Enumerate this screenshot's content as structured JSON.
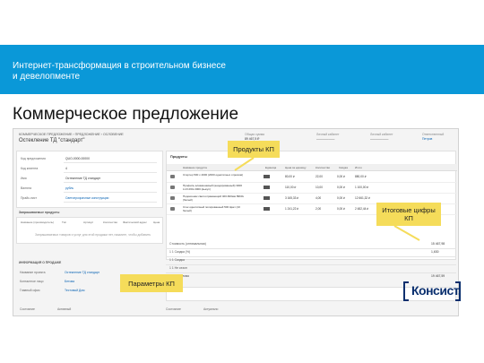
{
  "banner": {
    "title_line1": "Интернет-трансформация в строительном бизнесе",
    "title_line2": "и девелопменте"
  },
  "page_title": "Коммерческое предложение",
  "screenshot": {
    "breadcrumb": "КОММЕРЧЕСКОЕ ПРЕДЛОЖЕНИЕ › ПРЕДЛОЖЕНИЕ › ОСЛОВЕНИЕ",
    "record_name": "Остекление ТД \"стандарт\"",
    "header_cols": [
      {
        "label": "Общая сумма",
        "value": "89 467,5 ₽",
        "link": false
      },
      {
        "label": "Личный кабинет",
        "value": "——————",
        "link": false
      },
      {
        "label": "Личный кабинет",
        "value": "——————",
        "link": false
      },
      {
        "label": "Ответственный",
        "value": "Петров",
        "link": true
      }
    ],
    "fields": [
      {
        "label": "Код предложения",
        "value": "QUO-0000-00000",
        "link": false
      },
      {
        "label": "Код клиента",
        "value": "4",
        "link": false
      },
      {
        "label": "Имя",
        "value": "Остекление ТД стандарт",
        "link": false
      },
      {
        "label": "Валюта",
        "value": "рубль",
        "link": true
      },
      {
        "label": "Прайс-лист",
        "value": "Светопрозрачные конструкции",
        "link": true
      }
    ],
    "related_section": "Запрашиваемые продукты",
    "products_cols": [
      "Название (производитель)",
      "Тип",
      "Артикул",
      "Количество",
      "Фактический адрес",
      "Цена"
    ],
    "products_empty": "Запрашиваемых товаров и услуг для этой продажи нет, нажмите, чтобы добавить",
    "info_section": "ИНФОРМАЦИЯ О ПРОДАЖЕ",
    "rpanel_title": "Продукты",
    "table_headers": [
      "Название продукта",
      "Единица",
      "Цена за единицу",
      "Количество",
      "Скидка",
      "Итого"
    ],
    "rows": [
      {
        "name": "Стартер 500 х 4000 (2000 однотипных отрезков)",
        "price": "80,00 ₽",
        "qty": "22,00",
        "discount": "0,00 ₽",
        "total": "880,00 ₽"
      },
      {
        "name": "Профиль алюминиевый (анодированный) 3000 LUV-R01-3000 (выкуп)",
        "price": "110,00 ₽",
        "qty": "10,00",
        "discount": "0,00 ₽",
        "total": "1 100,00 ₽"
      },
      {
        "name": "Подоконник светоотражающий 400-600мм 8960x (белый)",
        "price": "3 165,33 ₽",
        "qty": "4,00",
        "discount": "0,00 ₽",
        "total": "12 661,32 ₽"
      },
      {
        "name": "Стек однотипный полированный 500 Цвет (10 белый)",
        "price": "1 241,22 ₽",
        "qty": "2,00",
        "discount": "0,00 ₽",
        "total": "2 482,44 ₽"
      }
    ],
    "totals": [
      {
        "label": "Стоимость (оптимальная)",
        "value": "15 467,98"
      },
      {
        "label": "1 1 Скидка (%)",
        "value": "1,630"
      },
      {
        "label": "1 1 Скидка",
        "value": ""
      },
      {
        "label": "1 1 Не сезон",
        "value": ""
      },
      {
        "label": "Общая сумма",
        "value": "19 467,59"
      }
    ],
    "info_fields": [
      {
        "label": "Название проекта",
        "value": "Остекление ТД стандарт",
        "link": true
      },
      {
        "label": "Контактное лицо",
        "value": "Бетова",
        "link": true
      },
      {
        "label": "Главный офис",
        "value": "Тестовый Дом",
        "link": true
      }
    ],
    "footer": [
      {
        "label": "Состояние",
        "value": "Активный"
      },
      {
        "label": "Состояние",
        "value": "Актуально"
      }
    ]
  },
  "callouts": {
    "products": "Продукты КП",
    "totals_line1": "Итоговые цифры",
    "totals_line2": "КП",
    "params": "Параметры КП"
  },
  "logo": {
    "text": "Консист."
  },
  "colors": {
    "banner": "#0a98d8",
    "callout": "#f5dc5a",
    "logo": "#0a2f6e",
    "link": "#0a64b4"
  }
}
